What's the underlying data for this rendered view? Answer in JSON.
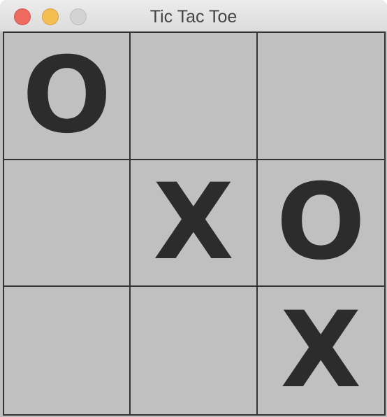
{
  "window": {
    "title": "Tic Tac Toe",
    "controls": {
      "close_color": "#ee6a5f",
      "minimize_color": "#f5bf4f",
      "zoom_color": "#d3d3d3"
    }
  },
  "board": {
    "cells": [
      "O",
      "",
      "",
      "",
      "X",
      "O",
      "",
      "",
      "X"
    ]
  }
}
